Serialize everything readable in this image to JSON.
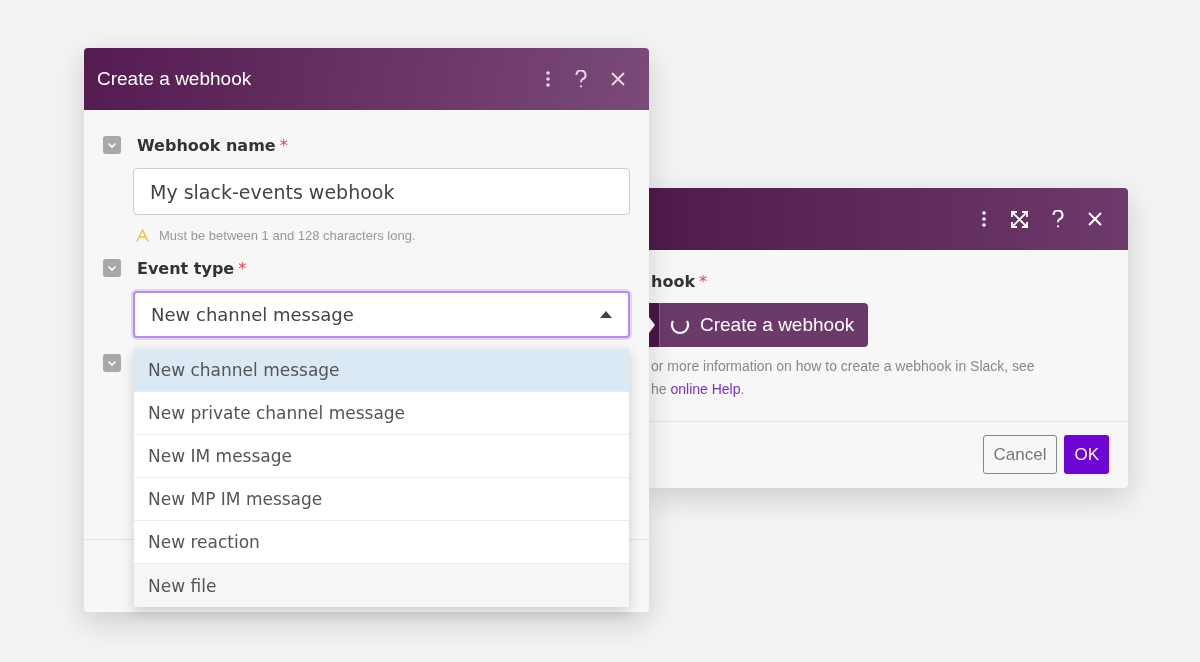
{
  "back_dialog": {
    "field_label": "hook",
    "required_mark": "*",
    "create_button": "Create a webhook",
    "help_line_1": "or more information on how to create a webhook in Slack, see",
    "help_line_2": "he",
    "help_link": "online Help",
    "help_suffix": ".",
    "buttons": [
      {
        "label": "Cancel",
        "kind": "secondary"
      },
      {
        "label": "OK",
        "kind": "primary"
      }
    ]
  },
  "front_dialog": {
    "title": "Create a webhook",
    "fields": [
      {
        "kind": "text",
        "label": "Webhook name",
        "required_mark": "*",
        "value": "My slack-events webhook",
        "hint": "Must be between 1 and 128 characters long."
      },
      {
        "kind": "select",
        "label": "Event type",
        "required_mark": "*",
        "value": "New channel message",
        "expanded": true
      },
      {
        "kind": "covered"
      }
    ],
    "options": [
      {
        "label": "New channel message",
        "selected": true
      },
      {
        "label": "New private channel message",
        "selected": false
      },
      {
        "label": "New IM message",
        "selected": false
      },
      {
        "label": "New MP IM message",
        "selected": false
      },
      {
        "label": "New reaction",
        "selected": false
      },
      {
        "label": "New file",
        "selected": false
      }
    ]
  }
}
